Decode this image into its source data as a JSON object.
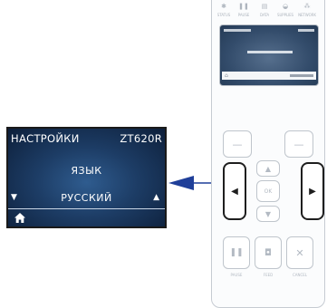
{
  "lcd": {
    "title": "НАСТРОЙКИ",
    "model": "ZT620R",
    "setting": "ЯЗЫК",
    "value": "РУССКИЙ",
    "left_arrow": "▼",
    "right_arrow": "▲",
    "home_icon": "home-icon"
  },
  "panel": {
    "indicators": [
      {
        "glyph": "✱",
        "label": "STATUS"
      },
      {
        "glyph": "❚❚",
        "label": "PAUSE"
      },
      {
        "glyph": "▤",
        "label": "DATA"
      },
      {
        "glyph": "◒",
        "label": "SUPPLIES"
      },
      {
        "glyph": "⁂",
        "label": "NETWORK"
      }
    ],
    "buttons": {
      "left_select": "—",
      "right_select": "—",
      "nav_left": "◀",
      "nav_right": "▶",
      "nav_up": "▲",
      "nav_down": "▼",
      "ok": "OK",
      "pause": "❚❚",
      "feed": "◘",
      "cancel": "✕"
    },
    "captions": {
      "pause": "PAUSE",
      "feed": "FEED",
      "cancel": "CANCEL"
    }
  },
  "colors": {
    "arrow": "#1f3f99",
    "lcd_bg": "#1d3d66",
    "panel_border": "#c6cbd2"
  }
}
